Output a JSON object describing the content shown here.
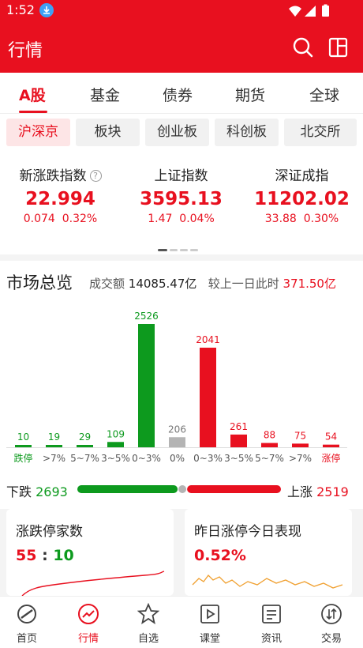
{
  "status": {
    "time": "1:52"
  },
  "appbar": {
    "title": "行情"
  },
  "tabs": [
    "A股",
    "基金",
    "债券",
    "期货",
    "全球"
  ],
  "chips": [
    "沪深京",
    "板块",
    "创业板",
    "科创板",
    "北交所"
  ],
  "indices": [
    {
      "name": "新涨跌指数",
      "value": "22.994",
      "change": "0.074",
      "pct": "0.32%"
    },
    {
      "name": "上证指数",
      "value": "3595.13",
      "change": "1.47",
      "pct": "0.04%"
    },
    {
      "name": "深证成指",
      "value": "11202.02",
      "change": "33.88",
      "pct": "0.30%"
    }
  ],
  "overview": {
    "title": "市场总览",
    "turnover_label": "成交额",
    "turnover": "14085.47亿",
    "compare_label": "较上一日此时",
    "compare": "371.50亿"
  },
  "chart_data": {
    "type": "bar",
    "categories": [
      "跌停",
      ">7%",
      "5~7%",
      "3~5%",
      "0~3%",
      "0%",
      "0~3%",
      "3~5%",
      "5~7%",
      ">7%",
      "涨停"
    ],
    "values": [
      10,
      19,
      29,
      109,
      2526,
      206,
      2041,
      261,
      88,
      75,
      54
    ],
    "colors": [
      "#0d9a1e",
      "#0d9a1e",
      "#0d9a1e",
      "#0d9a1e",
      "#0d9a1e",
      "#b4b4b4",
      "#e8101f",
      "#e8101f",
      "#e8101f",
      "#e8101f",
      "#e8101f"
    ],
    "ylim": [
      0,
      2526
    ]
  },
  "updown": {
    "down_label": "下跌",
    "down": 2693,
    "up_label": "上涨",
    "up": 2519
  },
  "cards": [
    {
      "title": "涨跌停家数",
      "value_left": "55",
      "sep": ":",
      "value_right": "10"
    },
    {
      "title": "昨日涨停今日表现",
      "value": "0.52%"
    }
  ],
  "nav": [
    "首页",
    "行情",
    "自选",
    "课堂",
    "资讯",
    "交易"
  ],
  "colors": {
    "red": "#e8101f",
    "green": "#0d9a1e",
    "gray": "#b4b4b4"
  }
}
